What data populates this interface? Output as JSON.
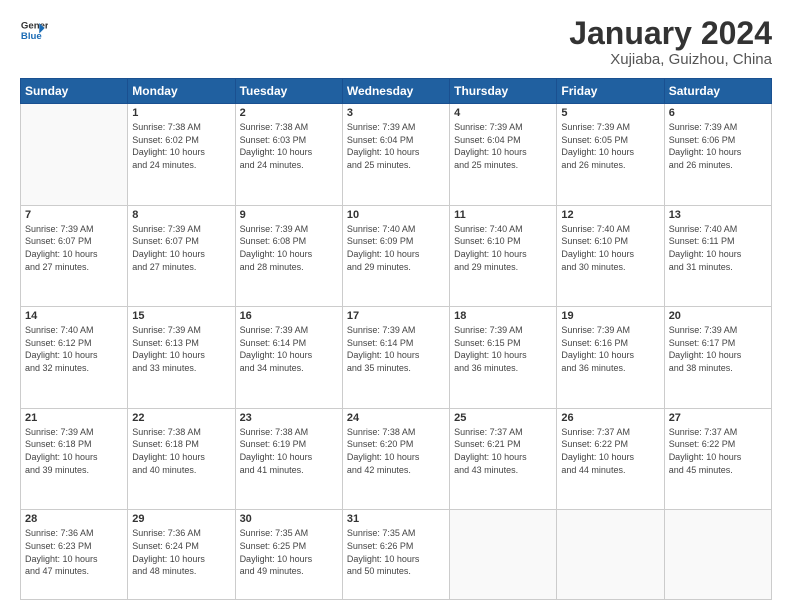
{
  "header": {
    "logo_general": "General",
    "logo_blue": "Blue",
    "month": "January 2024",
    "location": "Xujiaba, Guizhou, China"
  },
  "weekdays": [
    "Sunday",
    "Monday",
    "Tuesday",
    "Wednesday",
    "Thursday",
    "Friday",
    "Saturday"
  ],
  "weeks": [
    [
      {
        "day": "",
        "info": ""
      },
      {
        "day": "1",
        "info": "Sunrise: 7:38 AM\nSunset: 6:02 PM\nDaylight: 10 hours\nand 24 minutes."
      },
      {
        "day": "2",
        "info": "Sunrise: 7:38 AM\nSunset: 6:03 PM\nDaylight: 10 hours\nand 24 minutes."
      },
      {
        "day": "3",
        "info": "Sunrise: 7:39 AM\nSunset: 6:04 PM\nDaylight: 10 hours\nand 25 minutes."
      },
      {
        "day": "4",
        "info": "Sunrise: 7:39 AM\nSunset: 6:04 PM\nDaylight: 10 hours\nand 25 minutes."
      },
      {
        "day": "5",
        "info": "Sunrise: 7:39 AM\nSunset: 6:05 PM\nDaylight: 10 hours\nand 26 minutes."
      },
      {
        "day": "6",
        "info": "Sunrise: 7:39 AM\nSunset: 6:06 PM\nDaylight: 10 hours\nand 26 minutes."
      }
    ],
    [
      {
        "day": "7",
        "info": "Sunrise: 7:39 AM\nSunset: 6:07 PM\nDaylight: 10 hours\nand 27 minutes."
      },
      {
        "day": "8",
        "info": "Sunrise: 7:39 AM\nSunset: 6:07 PM\nDaylight: 10 hours\nand 27 minutes."
      },
      {
        "day": "9",
        "info": "Sunrise: 7:39 AM\nSunset: 6:08 PM\nDaylight: 10 hours\nand 28 minutes."
      },
      {
        "day": "10",
        "info": "Sunrise: 7:40 AM\nSunset: 6:09 PM\nDaylight: 10 hours\nand 29 minutes."
      },
      {
        "day": "11",
        "info": "Sunrise: 7:40 AM\nSunset: 6:10 PM\nDaylight: 10 hours\nand 29 minutes."
      },
      {
        "day": "12",
        "info": "Sunrise: 7:40 AM\nSunset: 6:10 PM\nDaylight: 10 hours\nand 30 minutes."
      },
      {
        "day": "13",
        "info": "Sunrise: 7:40 AM\nSunset: 6:11 PM\nDaylight: 10 hours\nand 31 minutes."
      }
    ],
    [
      {
        "day": "14",
        "info": "Sunrise: 7:40 AM\nSunset: 6:12 PM\nDaylight: 10 hours\nand 32 minutes."
      },
      {
        "day": "15",
        "info": "Sunrise: 7:39 AM\nSunset: 6:13 PM\nDaylight: 10 hours\nand 33 minutes."
      },
      {
        "day": "16",
        "info": "Sunrise: 7:39 AM\nSunset: 6:14 PM\nDaylight: 10 hours\nand 34 minutes."
      },
      {
        "day": "17",
        "info": "Sunrise: 7:39 AM\nSunset: 6:14 PM\nDaylight: 10 hours\nand 35 minutes."
      },
      {
        "day": "18",
        "info": "Sunrise: 7:39 AM\nSunset: 6:15 PM\nDaylight: 10 hours\nand 36 minutes."
      },
      {
        "day": "19",
        "info": "Sunrise: 7:39 AM\nSunset: 6:16 PM\nDaylight: 10 hours\nand 36 minutes."
      },
      {
        "day": "20",
        "info": "Sunrise: 7:39 AM\nSunset: 6:17 PM\nDaylight: 10 hours\nand 38 minutes."
      }
    ],
    [
      {
        "day": "21",
        "info": "Sunrise: 7:39 AM\nSunset: 6:18 PM\nDaylight: 10 hours\nand 39 minutes."
      },
      {
        "day": "22",
        "info": "Sunrise: 7:38 AM\nSunset: 6:18 PM\nDaylight: 10 hours\nand 40 minutes."
      },
      {
        "day": "23",
        "info": "Sunrise: 7:38 AM\nSunset: 6:19 PM\nDaylight: 10 hours\nand 41 minutes."
      },
      {
        "day": "24",
        "info": "Sunrise: 7:38 AM\nSunset: 6:20 PM\nDaylight: 10 hours\nand 42 minutes."
      },
      {
        "day": "25",
        "info": "Sunrise: 7:37 AM\nSunset: 6:21 PM\nDaylight: 10 hours\nand 43 minutes."
      },
      {
        "day": "26",
        "info": "Sunrise: 7:37 AM\nSunset: 6:22 PM\nDaylight: 10 hours\nand 44 minutes."
      },
      {
        "day": "27",
        "info": "Sunrise: 7:37 AM\nSunset: 6:22 PM\nDaylight: 10 hours\nand 45 minutes."
      }
    ],
    [
      {
        "day": "28",
        "info": "Sunrise: 7:36 AM\nSunset: 6:23 PM\nDaylight: 10 hours\nand 47 minutes."
      },
      {
        "day": "29",
        "info": "Sunrise: 7:36 AM\nSunset: 6:24 PM\nDaylight: 10 hours\nand 48 minutes."
      },
      {
        "day": "30",
        "info": "Sunrise: 7:35 AM\nSunset: 6:25 PM\nDaylight: 10 hours\nand 49 minutes."
      },
      {
        "day": "31",
        "info": "Sunrise: 7:35 AM\nSunset: 6:26 PM\nDaylight: 10 hours\nand 50 minutes."
      },
      {
        "day": "",
        "info": ""
      },
      {
        "day": "",
        "info": ""
      },
      {
        "day": "",
        "info": ""
      }
    ]
  ]
}
